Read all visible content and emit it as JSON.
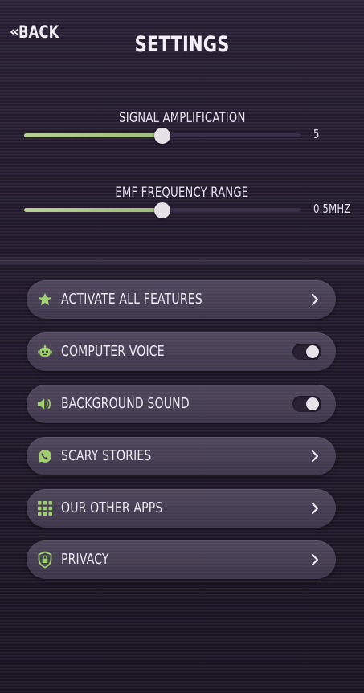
{
  "header": {
    "back_label": "BACK",
    "title": "SETTINGS"
  },
  "sliders": [
    {
      "label": "SIGNAL AMPLIFICATION",
      "value_text": "5",
      "level": 0.5
    },
    {
      "label": "EMF FREQUENCY RANGE",
      "value_text": "0.5MHZ",
      "level": 0.5
    }
  ],
  "menu": {
    "items": [
      {
        "label": "ACTIVATE ALL FEATURES",
        "icon": "star-icon",
        "control": "chevron"
      },
      {
        "label": "COMPUTER VOICE",
        "icon": "robot-icon",
        "control": "toggle",
        "on": true
      },
      {
        "label": "BACKGROUND SOUND",
        "icon": "speaker-icon",
        "control": "toggle",
        "on": true
      },
      {
        "label": "SCARY STORIES",
        "icon": "chat-bubble-icon",
        "control": "chevron"
      },
      {
        "label": "OUR OTHER APPS",
        "icon": "grid-icon",
        "control": "chevron"
      },
      {
        "label": "PRIVACY",
        "icon": "shield-lock-icon",
        "control": "chevron"
      }
    ]
  },
  "colors": {
    "accent_green": "#9fce6f",
    "slider_fill": "#a9c687",
    "background": "#241c2f",
    "row_background": "#6f6680"
  }
}
